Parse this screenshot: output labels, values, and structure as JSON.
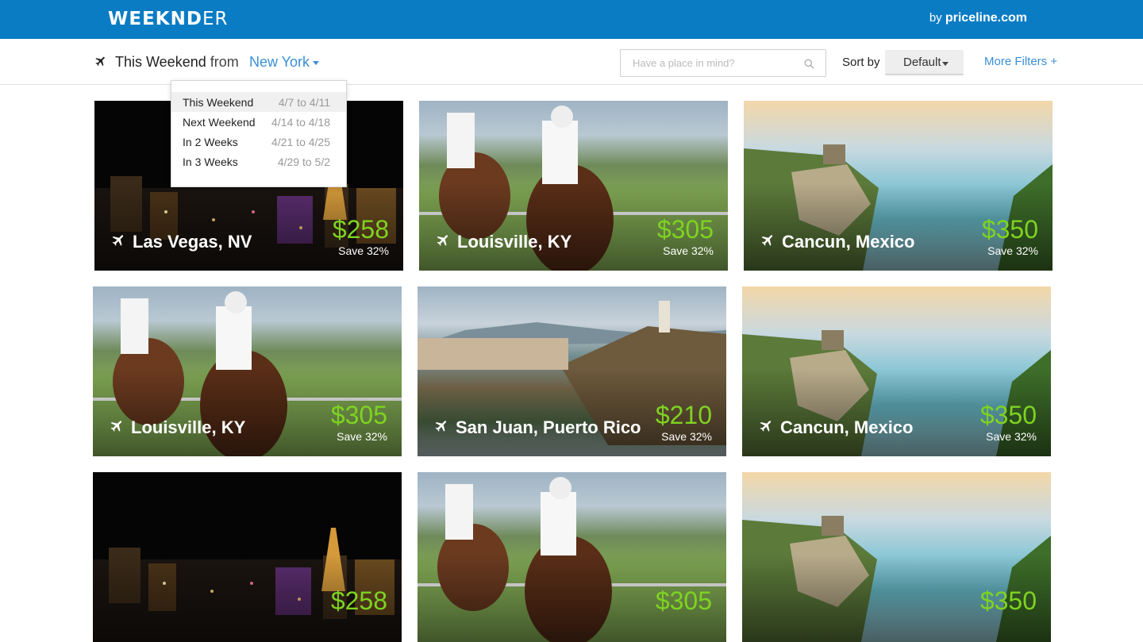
{
  "header": {
    "logo_bold": "WEEKND",
    "logo_light": "ER",
    "by_prefix": "by ",
    "by_brand": "priceline.com"
  },
  "filter": {
    "when": "This Weekend",
    "from": "from",
    "city": "New York",
    "search_placeholder": "Have a place in mind?",
    "sort_label": "Sort by",
    "sort_value": "Default",
    "more_filters": "More Filters +"
  },
  "dropdown": {
    "items": [
      {
        "label": "This Weekend",
        "range": "4/7 to 4/11"
      },
      {
        "label": "Next Weekend",
        "range": "4/14 to 4/18"
      },
      {
        "label": "In 2 Weeks",
        "range": "4/21 to 4/25"
      },
      {
        "label": "In 3 Weeks",
        "range": "4/29 to 5/2"
      }
    ]
  },
  "cards": [
    {
      "dest": "Las Vegas, NV",
      "price": "$258",
      "save": "Save 32%",
      "scene": "vegas"
    },
    {
      "dest": "Louisville, KY",
      "price": "$305",
      "save": "Save 32%",
      "scene": "horses"
    },
    {
      "dest": "Cancun, Mexico",
      "price": "$350",
      "save": "Save 32%",
      "scene": "cancun"
    },
    {
      "dest": "Louisville, KY",
      "price": "$305",
      "save": "Save 32%",
      "scene": "horses"
    },
    {
      "dest": "San Juan, Puerto Rico",
      "price": "$210",
      "save": "Save 32%",
      "scene": "sanjuan"
    },
    {
      "dest": "Cancun, Mexico",
      "price": "$350",
      "save": "Save 32%",
      "scene": "cancun"
    },
    {
      "dest": "",
      "price": "$258",
      "save": "",
      "scene": "vegas"
    },
    {
      "dest": "",
      "price": "$305",
      "save": "",
      "scene": "horses"
    },
    {
      "dest": "",
      "price": "$350",
      "save": "",
      "scene": "cancun"
    }
  ],
  "colors": {
    "brand_blue": "#0a7cc4",
    "link_blue": "#3a8fd6",
    "price_green": "#7ed321"
  }
}
